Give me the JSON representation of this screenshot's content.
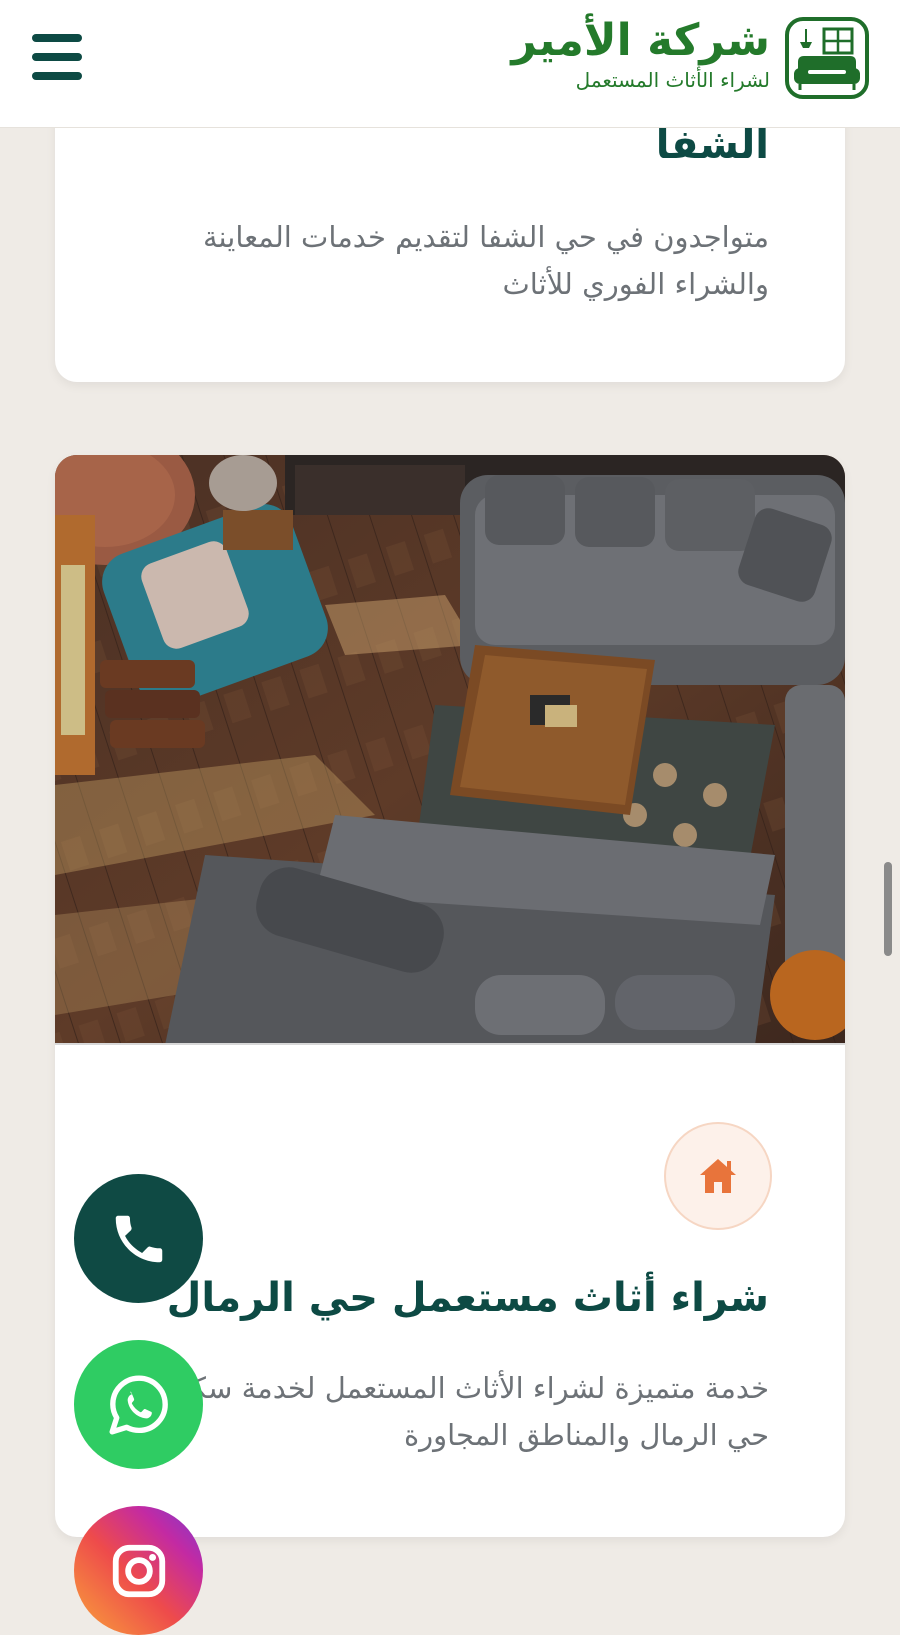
{
  "header": {
    "logo_title": "شركة الأمير",
    "logo_subtitle": "لشراء الأثاث المستعمل",
    "menu_icon": "hamburger-menu-icon",
    "logo_icon": "sofa-window-logo-icon"
  },
  "cards": [
    {
      "title": "الشفا",
      "description": "متواجدون في حي الشفا لتقديم خدمات المعاينة والشراء الفوري للأثاث"
    },
    {
      "image": "living-room-sofas-photo",
      "badge_icon": "home-icon",
      "title": "شراء أثاث مستعمل حي الرمال",
      "description": "خدمة متميزة لشراء الأثاث المستعمل لخدمة سكان حي الرمال والمناطق المجاورة"
    }
  ],
  "floating_buttons": [
    {
      "icon": "phone-icon"
    },
    {
      "icon": "whatsapp-icon"
    },
    {
      "icon": "instagram-icon"
    }
  ],
  "colors": {
    "brand_green": "#247a2b",
    "dark_teal": "#0d4a44",
    "background": "#efebe6",
    "accent_orange": "#e8743b",
    "whatsapp_green": "#2fcc63"
  }
}
